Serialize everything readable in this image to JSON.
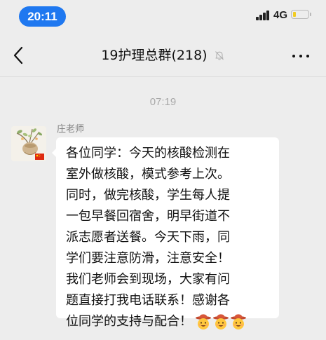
{
  "status_bar": {
    "time": "20:11",
    "network": "4G",
    "battery_level_fraction": 0.2,
    "battery_color": "#f2cc22",
    "accent_color": "#1f78f0"
  },
  "nav": {
    "title": "19护理总群(218)",
    "back_icon": "chevron-left-icon",
    "mute_icon": "bell-muted-icon",
    "more_icon": "more-dots-icon"
  },
  "chat": {
    "timestamp": "07:19",
    "messages": [
      {
        "sender": "庄老师",
        "avatar_icon": "teacher-avatar-with-flag",
        "lines": [
          "各位同学：今天的核酸检测在",
          "室外做核酸，模式参考上次。",
          "同时，做完核酸，学生每人提",
          "一包早餐回宿舍，明早街道不",
          "派志愿者送餐。今天下雨，同",
          "学们要注意防滑，注意安全！",
          "我们老师会到现场，大家有问",
          "题直接打我电话联系！感谢各",
          "位同学的支持与配合！"
        ],
        "trailing_emoji": [
          "cowboy-hat-face-emoji",
          "cowboy-hat-face-emoji",
          "cowboy-hat-face-emoji"
        ]
      }
    ]
  }
}
